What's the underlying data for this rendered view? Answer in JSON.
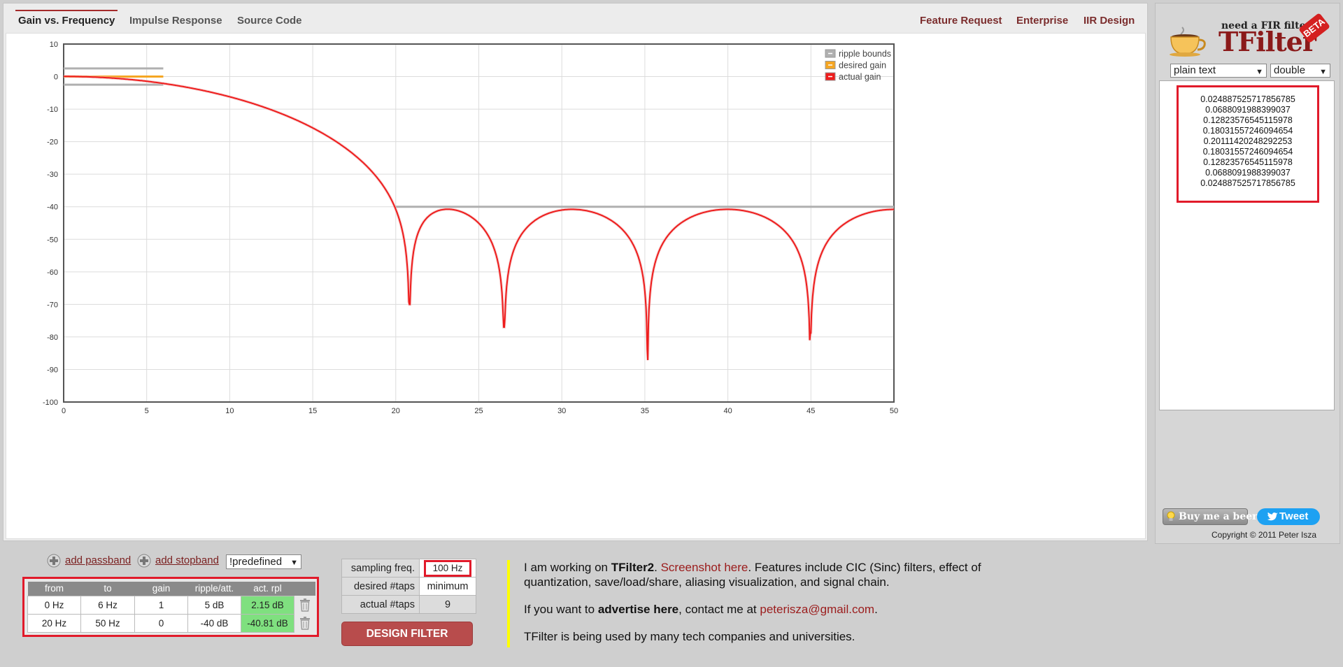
{
  "tabs": {
    "left": [
      "Gain vs. Frequency",
      "Impulse Response",
      "Source Code"
    ],
    "right": [
      "Feature Request",
      "Enterprise",
      "IIR Design"
    ],
    "active": "Gain vs. Frequency"
  },
  "chart_data": {
    "type": "line",
    "title": "",
    "xlabel": "",
    "ylabel": "",
    "xlim": [
      0,
      50
    ],
    "ylim": [
      -100,
      10
    ],
    "x_ticks": [
      0,
      5,
      10,
      15,
      20,
      25,
      30,
      35,
      40,
      45,
      50
    ],
    "y_ticks": [
      10,
      0,
      -10,
      -20,
      -30,
      -40,
      -50,
      -60,
      -70,
      -80,
      -90,
      -100
    ],
    "grid": true,
    "legend_position": "top-right",
    "legend": [
      "ripple bounds",
      "desired gain",
      "actual gain"
    ],
    "colors": {
      "ripple_bounds": "#b0b0b0",
      "desired_gain": "#f5a623",
      "actual_gain": "#ee1c1c"
    },
    "ripple_bounds": [
      {
        "x": [
          0,
          6
        ],
        "y_upper": 2.5,
        "y_lower": -2.5
      },
      {
        "x": [
          20,
          50
        ],
        "y": -40
      }
    ],
    "desired_gain": [
      {
        "x": [
          0,
          6
        ],
        "y": 0
      }
    ],
    "actual_gain_taps": [
      0.024887525717856785,
      0.0688091988399037,
      0.12823576545115978,
      0.18031557246094654,
      0.20111420248292253,
      0.18031557246094654,
      0.12823576545115978,
      0.0688091988399037,
      0.024887525717856785
    ],
    "actual_gain_sample_rate": 100,
    "actual_gain_notches": [
      {
        "x": 20.8,
        "y": -70
      },
      {
        "x": 26.5,
        "y": -77
      },
      {
        "x": 35.1,
        "y": -92
      },
      {
        "x": 45.0,
        "y": -79
      }
    ]
  },
  "sidebar": {
    "logo_tagline": "need a FIR filter?",
    "logo_title": "TFilter",
    "logo_badge": "BETA",
    "format_selected": "plain text",
    "precision_selected": "double",
    "coefficients": [
      "0.024887525717856785",
      "0.0688091988399037",
      "0.12823576545115978",
      "0.18031557246094654",
      "0.20111420248292253",
      "0.18031557246094654",
      "0.12823576545115978",
      "0.0688091988399037",
      "0.024887525717856785"
    ],
    "beer_button": "Buy me a beer",
    "tweet_button": "Tweet",
    "copyright": "Copyright © 2011 Peter Isza"
  },
  "bands": {
    "add_passband": "add passband",
    "add_stopband": "add stopband",
    "predefined": "!predefined",
    "headers": [
      "from",
      "to",
      "gain",
      "ripple/att.",
      "act. rpl"
    ],
    "rows": [
      {
        "from": "0 Hz",
        "to": "6 Hz",
        "gain": "1",
        "ripple": "5 dB",
        "act": "2.15 dB"
      },
      {
        "from": "20 Hz",
        "to": "50 Hz",
        "gain": "0",
        "ripple": "-40 dB",
        "act": "-40.81 dB"
      }
    ]
  },
  "params": {
    "sampling_label": "sampling freq.",
    "sampling_value": "100 Hz",
    "desired_label": "desired #taps",
    "desired_value": "minimum",
    "actual_label": "actual #taps",
    "actual_value": "9",
    "design_button": "DESIGN FILTER"
  },
  "info": {
    "p1_a": "I am working on ",
    "p1_b": "TFilter2",
    "p1_c": ". ",
    "p1_link": "Screenshot here",
    "p1_d": ". Features include CIC (Sinc) filters, effect of quantization, save/load/share, aliasing visualization, and signal chain.",
    "p2_a": "If you want to ",
    "p2_b": "advertise here",
    "p2_c": ", contact me at ",
    "p2_link": "peterisza@gmail.com",
    "p2_d": ".",
    "p3": "TFilter is being used by many tech companies and universities."
  }
}
